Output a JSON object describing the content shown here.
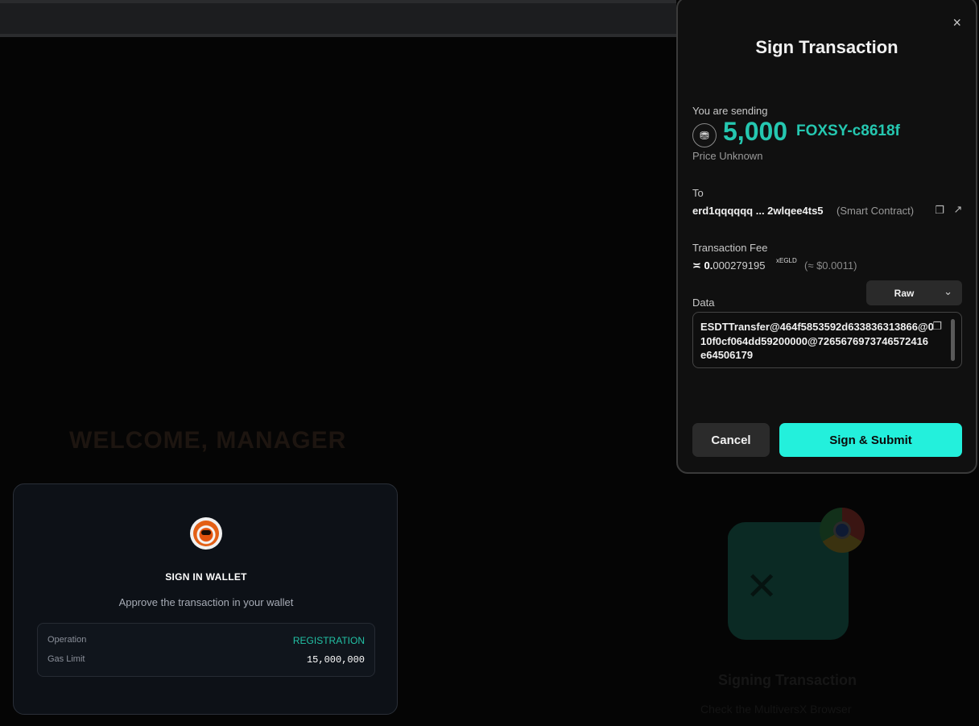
{
  "background": {
    "welcome_text": "WELCOME, MANAGER",
    "signing_title": "Signing Transaction",
    "signing_sub": "Check the MultiversX Browser"
  },
  "card": {
    "title": "SIGN IN WALLET",
    "subtitle": "Approve the transaction in your wallet",
    "rows": [
      {
        "label": "Operation",
        "value": "REGISTRATION"
      },
      {
        "label": "Gas Limit",
        "value": "15,000,000"
      }
    ],
    "accent": "#22c1a5"
  },
  "modal": {
    "close_label": "×",
    "title": "Sign Transaction",
    "sending_label": "You are sending",
    "amount": "5,000",
    "ticker": "FOXSY-c8618f",
    "price": "Price Unknown",
    "to_label": "To",
    "address": "erd1qqqqqq ... 2wlqee4ts5",
    "address_type": "(Smart Contract)",
    "fee_label": "Transaction Fee",
    "fee_prefix": "≍",
    "fee_int": "0.",
    "fee_dec": "000279195",
    "fee_unit": "xEGLD",
    "fee_usd": "(≈ $0.0011)",
    "data_label": "Data",
    "data_format": "Raw",
    "data_value": "ESDTTransfer@464f5853592d633836313866@010f0cf064dd59200000@7265676973746572416e64506179",
    "cancel_label": "Cancel",
    "sign_label": "Sign & Submit",
    "accent": "#25c7b0",
    "button_color": "#23f0dc"
  }
}
